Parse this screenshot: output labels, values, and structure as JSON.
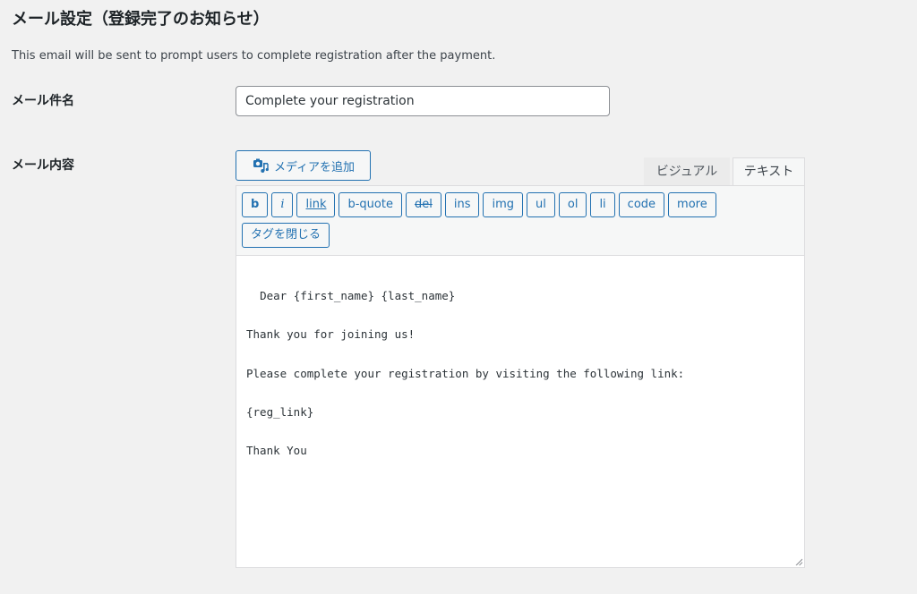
{
  "section": {
    "title": "メール設定（登録完了のお知らせ）",
    "description": "This email will be sent to prompt users to complete registration after the payment."
  },
  "subject": {
    "label": "メール件名",
    "value": "Complete your registration"
  },
  "content": {
    "label": "メール内容",
    "media_button_label": "メディアを追加",
    "media_icon": "media-camera-music-icon",
    "tabs": {
      "visual": "ビジュアル",
      "text": "テキスト",
      "active": "text"
    },
    "quicktags": [
      "b",
      "i",
      "link",
      "b-quote",
      "del",
      "ins",
      "img",
      "ul",
      "ol",
      "li",
      "code",
      "more"
    ],
    "close_tags_label": "タグを閉じる",
    "body": "Dear {first_name} {last_name}\n\nThank you for joining us!\n\nPlease complete your registration by visiting the following link:\n\n{reg_link}\n\nThank You"
  },
  "colors": {
    "accent": "#2271b1",
    "background": "#f1f1f1"
  }
}
